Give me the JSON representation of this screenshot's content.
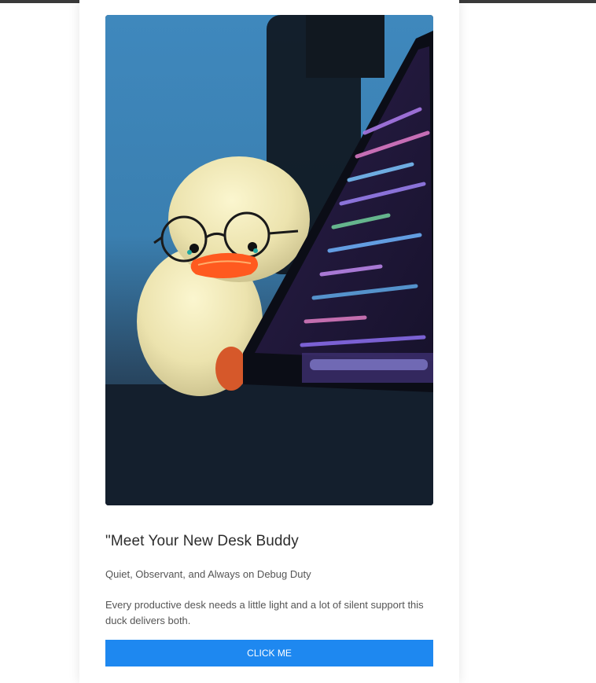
{
  "card": {
    "image_subject": "rubber-duck-lamp-with-glasses-beside-laptop",
    "title": "\"Meet Your New Desk Buddy",
    "subtitle": "Quiet, Observant, and Always on Debug Duty",
    "description": "Every productive desk needs a little light and a lot of silent support this duck delivers both.",
    "button_label": "CLICK ME"
  },
  "colors": {
    "accent": "#1e88f0",
    "title_text": "#2d2d2d",
    "body_text": "#555555",
    "top_bar": "#3a3a3a"
  }
}
